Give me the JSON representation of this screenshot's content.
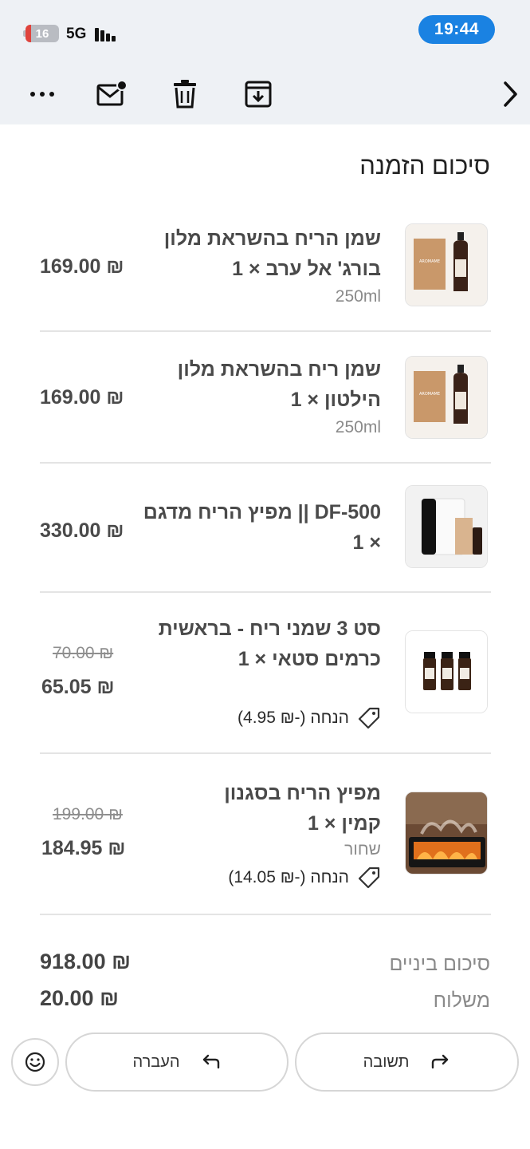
{
  "status_bar": {
    "battery_level": "16",
    "network": "5G",
    "time": "19:44",
    "battery_color": "#e0433c",
    "time_pill_color": "#1a82e2"
  },
  "toolbar": {
    "icons": [
      "more-icon",
      "mark-unread-icon",
      "trash-icon",
      "archive-icon",
      "back-chevron-icon"
    ]
  },
  "order": {
    "title": "סיכום הזמנה",
    "items": [
      {
        "name": "שמן הריח בהשראת מלון בורג' אל ערב × 1",
        "variant": "250ml",
        "price": "₪ 169.00"
      },
      {
        "name": "שמן ריח בהשראת מלון הילטון × 1",
        "variant": "250ml",
        "price": "₪ 169.00"
      },
      {
        "name": "DF-500 || מפיץ הריח מדגם × 1",
        "price": "₪ 330.00"
      },
      {
        "name": "סט 3 שמני ריח - בראשית כרמים סטאי × 1",
        "old_price": "₪ 70.00",
        "price": "₪ 65.05",
        "discount": "הנחה (-₪ 4.95)"
      },
      {
        "name": "מפיץ הריח בסגנון קמין × 1",
        "variant": "שחור",
        "old_price": "₪ 199.00",
        "price": "₪ 184.95",
        "discount": "הנחה (-₪ 14.05)"
      }
    ],
    "subtotal_label": "סיכום ביניים",
    "subtotal_value": "₪ 918.00",
    "shipping_label": "משלוח",
    "shipping_value": "₪ 20.00"
  },
  "actions": {
    "forward_label": "העברה",
    "reply_label": "תשובה"
  }
}
